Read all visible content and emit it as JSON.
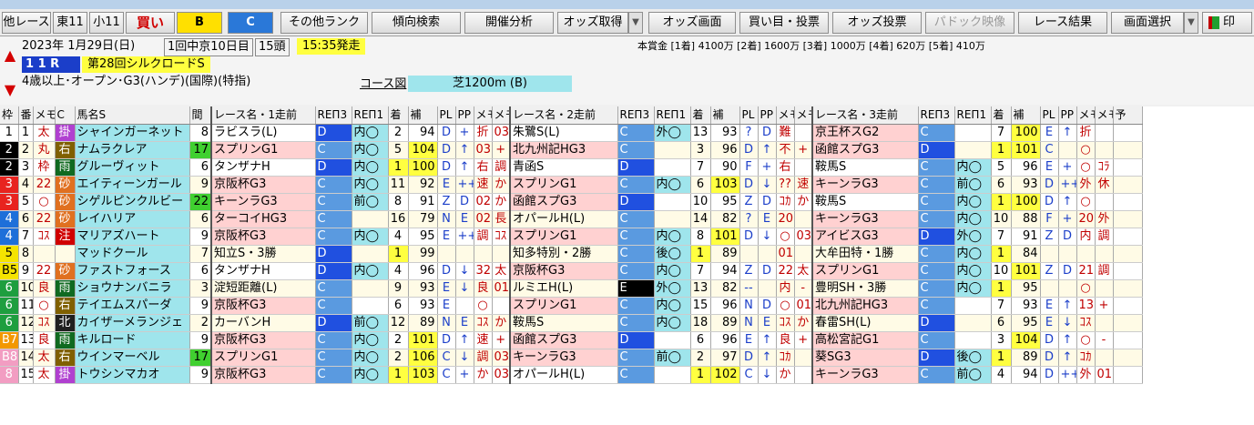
{
  "toolbar": {
    "left_group": [
      "他レース",
      "東11",
      "小11",
      "買い",
      "B",
      "C"
    ],
    "buttons": [
      "その他ランク",
      "傾向検索",
      "開催分析",
      "オッズ取得",
      "オッズ画面",
      "買い目・投票",
      "オッズ投票",
      "パドック映像",
      "レース結果",
      "画面選択"
    ],
    "tail": "印"
  },
  "race": {
    "date": "2023年 1月29日(日)",
    "meeting": "1回中京10日目",
    "runners": "15頭",
    "post_time": "15:35発走",
    "prize": "本賞金 [1着] 4100万 [2着] 1600万 [3着] 1000万 [4着] 620万 [5着] 410万",
    "race_no": "1 1 R",
    "race_name": "第28回シルクロードS",
    "conditions": "4歳以上･オープン･G3(ハンデ)(国際)(特指)",
    "course_label": "コース図",
    "course": "芝1200m (B)"
  },
  "columns": [
    "枠",
    "番",
    "メモ",
    "C",
    "馬名S",
    "間",
    "レース名・1走前",
    "REΠ3",
    "REΠ1",
    "着",
    "補",
    "PL",
    "PP",
    "メモ",
    "メモ",
    "レース名・2走前",
    "REΠ3",
    "REΠ1",
    "着",
    "補",
    "PL",
    "PP",
    "メモ",
    "メモ",
    "レース名・3走前",
    "REΠ3",
    "REΠ1",
    "着",
    "補",
    "PL",
    "PP",
    "メモ",
    "メモ",
    "予"
  ],
  "colors": {
    "waku": [
      "#ffffff",
      "#000000",
      "#e8231f",
      "#1e6fd9",
      "#f5e400",
      "#1e9e3f",
      "#f39800",
      "#f29dc2"
    ],
    "grade": "#ff7d7d",
    "c_blue": "#2050e0",
    "pink": "#ffd1d1",
    "teal": "#9fe5ec"
  },
  "horses": [
    {
      "waku": "1",
      "num": "1",
      "memo": "太",
      "mark": "掛",
      "name": "シャインガーネット",
      "int": "8",
      "r1": "ラビスラ(L)",
      "p3": "D",
      "p1": "内◯",
      "f1": "2",
      "h1": "94",
      "l1": "D",
      "pp1": "+",
      "m1": "折",
      "n1": "03",
      "r2": "朱鷺S(L)",
      "q3": "C",
      "q1": "外◯",
      "f2": "13",
      "h2": "93",
      "l2": "?",
      "pp2": "D",
      "m2": "難",
      "n2": "",
      "r3": "京王杯スG2",
      "s3": "C",
      "s1": "",
      "f3": "7",
      "h3": "100",
      "l3": "E",
      "pp3": "↑",
      "m3": "折",
      "n3": ""
    },
    {
      "waku": "2",
      "num": "2",
      "memo": "丸",
      "mark": "右",
      "name": "ナムラクレア",
      "int": "17",
      "r1": "スプリンG1",
      "p3": "C",
      "p1": "内◯",
      "f1": "5",
      "h1": "104",
      "l1": "D",
      "pp1": "↑",
      "m1": "03",
      "n1": "+",
      "r2": "北九州記HG3",
      "q3": "C",
      "q1": "",
      "f2": "3",
      "h2": "96",
      "l2": "D",
      "pp2": "↑",
      "m2": "不",
      "n2": "+",
      "r3": "函館スプG3",
      "s3": "D",
      "s1": "",
      "f3": "1",
      "h3": "101",
      "l3": "C",
      "pp3": "",
      "m3": "○",
      "n3": ""
    },
    {
      "waku": "2",
      "num": "3",
      "memo": "枠",
      "mark": "雨",
      "name": "グルーヴィット",
      "int": "6",
      "r1": "タンザナH",
      "p3": "D",
      "p1": "内◯",
      "f1": "1",
      "h1": "100",
      "l1": "D",
      "pp1": "↑",
      "m1": "右",
      "n1": "調",
      "r2": "青函S",
      "q3": "D",
      "q1": "",
      "f2": "7",
      "h2": "90",
      "l2": "F",
      "pp2": "+",
      "m2": "右",
      "n2": "",
      "r3": "鞍馬S",
      "s3": "C",
      "s1": "内◯",
      "f3": "5",
      "h3": "96",
      "l3": "E",
      "pp3": "+",
      "m3": "○",
      "n3": "ｺﾗ"
    },
    {
      "waku": "3",
      "num": "4",
      "memo": "22",
      "mark": "砂",
      "name": "エイティーンガール",
      "int": "9",
      "r1": "京阪杯G3",
      "p3": "C",
      "p1": "内◯",
      "f1": "11",
      "h1": "92",
      "l1": "E",
      "pp1": "++",
      "m1": "速",
      "n1": "か",
      "r2": "スプリンG1",
      "q3": "C",
      "q1": "内◯",
      "f2": "6",
      "h2": "103",
      "l2": "D",
      "pp2": "↓",
      "m2": "??",
      "n2": "速",
      "r3": "キーンラG3",
      "s3": "C",
      "s1": "前◯",
      "f3": "6",
      "h3": "93",
      "l3": "D",
      "pp3": "++",
      "m3": "外",
      "n3": "休"
    },
    {
      "waku": "3",
      "num": "5",
      "memo": "○",
      "mark": "砂",
      "name": "シゲルピンクルビー",
      "int": "22",
      "r1": "キーンラG3",
      "p3": "C",
      "p1": "前◯",
      "f1": "8",
      "h1": "91",
      "l1": "Z",
      "pp1": "D",
      "m1": "02",
      "n1": "か",
      "r2": "函館スプG3",
      "q3": "D",
      "q1": "",
      "f2": "10",
      "h2": "95",
      "l2": "Z",
      "pp2": "D",
      "m2": "ｺｶ",
      "n2": "か",
      "r3": "鞍馬S",
      "s3": "C",
      "s1": "内◯",
      "f3": "1",
      "h3": "100",
      "l3": "D",
      "pp3": "↑",
      "m3": "○",
      "n3": ""
    },
    {
      "waku": "4",
      "num": "6",
      "memo": "22",
      "mark": "砂",
      "name": "レイハリア",
      "int": "6",
      "r1": "ターコイHG3",
      "p3": "C",
      "p1": "",
      "f1": "16",
      "h1": "79",
      "l1": "N",
      "pp1": "E",
      "m1": "02",
      "n1": "長",
      "r2": "オパールH(L)",
      "q3": "C",
      "q1": "",
      "f2": "14",
      "h2": "82",
      "l2": "?",
      "pp2": "E",
      "m2": "20",
      "n2": "",
      "r3": "キーンラG3",
      "s3": "C",
      "s1": "内◯",
      "f3": "10",
      "h3": "88",
      "l3": "F",
      "pp3": "+",
      "m3": "20",
      "n3": "外"
    },
    {
      "waku": "4",
      "num": "7",
      "memo": "ｺｽ",
      "mark": "注",
      "name": "マリアズハート",
      "int": "9",
      "r1": "京阪杯G3",
      "p3": "C",
      "p1": "内◯",
      "f1": "4",
      "h1": "95",
      "l1": "E",
      "pp1": "++",
      "m1": "調",
      "n1": "ｺｽ",
      "r2": "スプリンG1",
      "q3": "C",
      "q1": "内◯",
      "f2": "8",
      "h2": "101",
      "l2": "D",
      "pp2": "↓",
      "m2": "○",
      "n2": "03",
      "r3": "アイビスG3",
      "s3": "D",
      "s1": "外◯",
      "f3": "7",
      "h3": "91",
      "l3": "Z",
      "pp3": "D",
      "m3": "内",
      "n3": "調"
    },
    {
      "waku": "5",
      "num": "8",
      "memo": "",
      "mark": "",
      "name": "マッドクール",
      "int": "7",
      "r1": "知立S・3勝",
      "p3": "D",
      "p1": "",
      "f1": "1",
      "h1": "99",
      "l1": "",
      "pp1": "",
      "m1": "",
      "n1": "",
      "r2": "知多特別・2勝",
      "q3": "C",
      "q1": "後◯",
      "f2": "1",
      "h2": "89",
      "l2": "",
      "pp2": "",
      "m2": "01",
      "n2": "",
      "r3": "大牟田特・1勝",
      "s3": "C",
      "s1": "内◯",
      "f3": "1",
      "h3": "84",
      "l3": "",
      "pp3": "",
      "m3": "",
      "n3": ""
    },
    {
      "waku": "B5",
      "num": "9",
      "memo": "22",
      "mark": "砂",
      "name": "ファストフォース",
      "int": "6",
      "r1": "タンザナH",
      "p3": "D",
      "p1": "内◯",
      "f1": "4",
      "h1": "96",
      "l1": "D",
      "pp1": "↓",
      "m1": "32",
      "n1": "太",
      "r2": "京阪杯G3",
      "q3": "C",
      "q1": "内◯",
      "f2": "7",
      "h2": "94",
      "l2": "Z",
      "pp2": "D",
      "m2": "22",
      "n2": "太",
      "r3": "スプリンG1",
      "s3": "C",
      "s1": "内◯",
      "f3": "10",
      "h3": "101",
      "l3": "Z",
      "pp3": "D",
      "m3": "21",
      "n3": "調"
    },
    {
      "waku": "6",
      "num": "10",
      "memo": "良",
      "mark": "雨",
      "name": "ショウナンバニラ",
      "int": "3",
      "r1": "淀短距離(L)",
      "p3": "C",
      "p1": "",
      "f1": "9",
      "h1": "93",
      "l1": "E",
      "pp1": "↓",
      "m1": "良",
      "n1": "01",
      "r2": "ルミエH(L)",
      "q3": "E",
      "q1": "外◯",
      "f2": "13",
      "h2": "82",
      "l2": "--",
      "pp2": "",
      "m2": "内",
      "n2": "-",
      "r3": "豊明SH・3勝",
      "s3": "C",
      "s1": "内◯",
      "f3": "1",
      "h3": "95",
      "l3": "",
      "pp3": "",
      "m3": "○",
      "n3": ""
    },
    {
      "waku": "6",
      "num": "11",
      "memo": "○",
      "mark": "右",
      "name": "テイエムスパーダ",
      "int": "9",
      "r1": "京阪杯G3",
      "p3": "C",
      "p1": "",
      "f1": "6",
      "h1": "93",
      "l1": "E",
      "pp1": "",
      "m1": "○",
      "n1": "",
      "r2": "スプリンG1",
      "q3": "C",
      "q1": "内◯",
      "f2": "15",
      "h2": "96",
      "l2": "N",
      "pp2": "D",
      "m2": "○",
      "n2": "01",
      "r3": "北九州記HG3",
      "s3": "C",
      "s1": "",
      "f3": "7",
      "h3": "93",
      "l3": "E",
      "pp3": "↑",
      "m3": "13",
      "n3": "+"
    },
    {
      "waku": "6",
      "num": "12",
      "memo": "ｺｽ",
      "mark": "北",
      "name": "カイザーメランジェ",
      "int": "2",
      "r1": "カーバンH",
      "p3": "D",
      "p1": "前◯",
      "f1": "12",
      "h1": "89",
      "l1": "N",
      "pp1": "E",
      "m1": "ｺｽ",
      "n1": "か",
      "r2": "鞍馬S",
      "q3": "C",
      "q1": "内◯",
      "f2": "18",
      "h2": "89",
      "l2": "N",
      "pp2": "E",
      "m2": "ｺｽ",
      "n2": "か",
      "r3": "春雷SH(L)",
      "s3": "D",
      "s1": "",
      "f3": "6",
      "h3": "95",
      "l3": "E",
      "pp3": "↓",
      "m3": "ｺｽ",
      "n3": ""
    },
    {
      "waku": "B7",
      "num": "13",
      "memo": "良",
      "mark": "雨",
      "name": "キルロード",
      "int": "9",
      "r1": "京阪杯G3",
      "p3": "C",
      "p1": "内◯",
      "f1": "2",
      "h1": "101",
      "l1": "D",
      "pp1": "↑",
      "m1": "速",
      "n1": "+",
      "r2": "函館スプG3",
      "q3": "D",
      "q1": "",
      "f2": "6",
      "h2": "96",
      "l2": "E",
      "pp2": "↑",
      "m2": "良",
      "n2": "+",
      "r3": "高松宮記G1",
      "s3": "C",
      "s1": "",
      "f3": "3",
      "h3": "104",
      "l3": "D",
      "pp3": "↑",
      "m3": "○",
      "n3": "-"
    },
    {
      "waku": "B8",
      "num": "14",
      "memo": "太",
      "mark": "右",
      "name": "ウインマーベル",
      "int": "17",
      "r1": "スプリンG1",
      "p3": "C",
      "p1": "内◯",
      "f1": "2",
      "h1": "106",
      "l1": "C",
      "pp1": "↓",
      "m1": "調",
      "n1": "03",
      "r2": "キーンラG3",
      "q3": "C",
      "q1": "前◯",
      "f2": "2",
      "h2": "97",
      "l2": "D",
      "pp2": "↑",
      "m2": "ｺｶ",
      "n2": "",
      "r3": "葵SG3",
      "s3": "D",
      "s1": "後◯",
      "f3": "1",
      "h3": "89",
      "l3": "D",
      "pp3": "↑",
      "m3": "ｺｶ",
      "n3": ""
    },
    {
      "waku": "8",
      "num": "15",
      "memo": "太",
      "mark": "掛",
      "name": "トウシンマカオ",
      "int": "9",
      "r1": "京阪杯G3",
      "p3": "C",
      "p1": "内◯",
      "f1": "1",
      "h1": "103",
      "l1": "C",
      "pp1": "+",
      "m1": "か",
      "n1": "03",
      "r2": "オパールH(L)",
      "q3": "C",
      "q1": "",
      "f2": "1",
      "h2": "102",
      "l2": "C",
      "pp2": "↓",
      "m2": "か",
      "n2": "",
      "r3": "キーンラG3",
      "s3": "C",
      "s1": "前◯",
      "f3": "4",
      "h3": "94",
      "l3": "D",
      "pp3": "++",
      "m3": "外",
      "n3": "01"
    }
  ]
}
